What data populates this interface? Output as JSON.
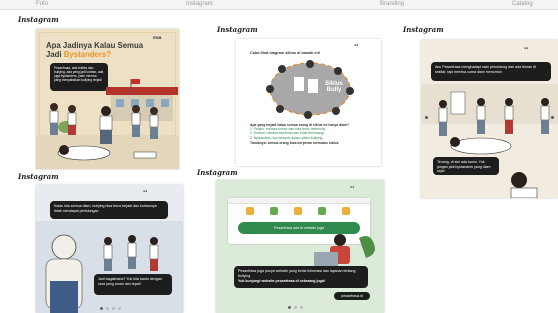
{
  "top_strip": [
    "Foto",
    "Instagram",
    "Branding",
    "Catalog"
  ],
  "source_label": "Instagram",
  "posts": [
    {
      "title_line1": "Apa Jadinya Kalau Semua",
      "title_line2_prefix": "Jadi ",
      "title_highlight": "Bystanders?",
      "intro": "Pesanfrasa, ada bullies dan bullying, ada yang jadi korban, ada juga bystanders, yaitu mereka yang menyaksikan bullying terjadi",
      "brand": "RSB"
    },
    {
      "heading": "Coba lihat diagram siklus di bawah ini!",
      "center_label": "Siklus Bully",
      "question": "Apa yang terjadi kalau semua orang di siklus ini hanya diam?",
      "answer_lines": [
        "1. Pelaku: merasa bebas dan bisa terus membully",
        "2. Korban: merasa sendirian dan tidak terlindungi",
        "3. Bystanders: ikut terseret dalam siklus bullying"
      ],
      "conclusion": "Tandanya: semua orang bisa berperan memutus siklus"
    },
    {
      "bubble1": "Aku Pesanfrasa menghadapi satu perundung dan ada teman di sekitar, tapi mereka cuma diam menonton",
      "bubble2": "Tenang, di sini ada kamu. Yuk jangan jadi bystanders yang diam saja!"
    },
    {
      "bubble1": "Kalau kita semua diam, bullying bisa terus terjadi dan korbannya tidak mendapat pertolongan",
      "bubble2": "Jadi bagaimana? Yuk kita bantu dengan cara yang aman dan tepat!"
    },
    {
      "website_banner": "Pesanfrasa ada di website juga",
      "bubble": "Pesanfrasa juga punya website yang berisi informasi dan layanan tentang bullying",
      "cta": "Yuk kunjungi website pesanfrasa di sekarang juga!",
      "button": "pesanfrasa.id"
    }
  ],
  "colors": {
    "post_a_bg": "#ede0c4",
    "highlight": "#f2a23a",
    "post_c_bg": "#f1ecdf",
    "post_e_bg": "#dcebd9",
    "green": "#2f8a4e",
    "dark_bubble": "#1d1d1d"
  }
}
